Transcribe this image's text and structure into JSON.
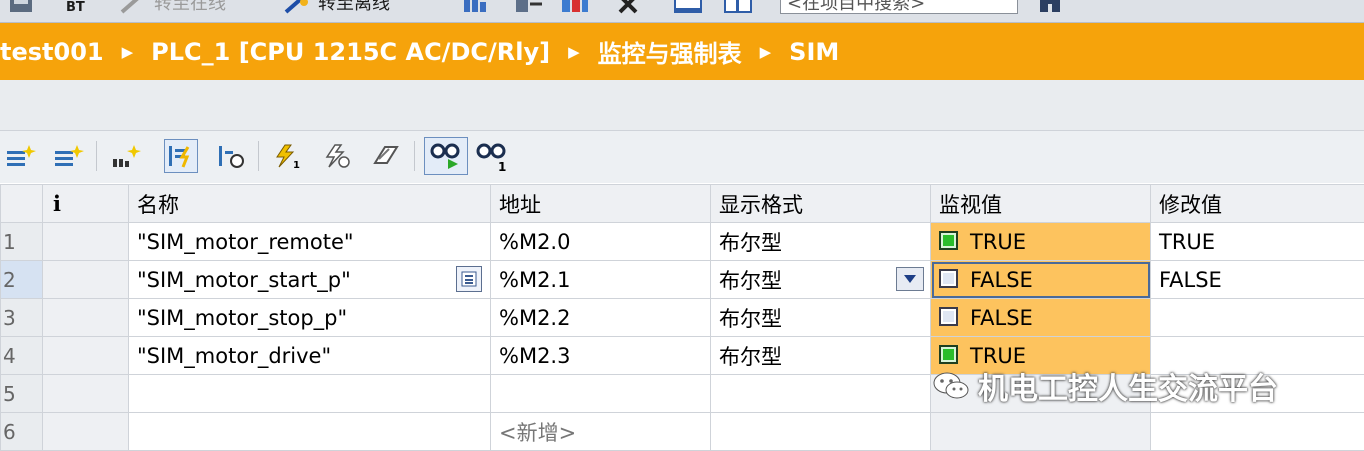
{
  "topbar": {
    "go_online": "转至在线",
    "go_offline": "转至离线",
    "search_placeholder": "<在项目中搜索>",
    "items": [
      "BT"
    ]
  },
  "breadcrumb": [
    "test001",
    "PLC_1 [CPU 1215C AC/DC/Rly]",
    "监控与强制表",
    "SIM"
  ],
  "columns": [
    "i",
    "名称",
    "地址",
    "显示格式",
    "监视值",
    "修改值"
  ],
  "rows": [
    {
      "num": "1",
      "name": "\"SIM_motor_remote\"",
      "address": "%M2.0",
      "format": "布尔型",
      "monitor": "TRUE",
      "monitor_state": "on",
      "modify": "TRUE"
    },
    {
      "num": "2",
      "name": "\"SIM_motor_start_p\"",
      "address": "%M2.1",
      "format": "布尔型",
      "monitor": "FALSE",
      "monitor_state": "off",
      "modify": "FALSE"
    },
    {
      "num": "3",
      "name": "\"SIM_motor_stop_p\"",
      "address": "%M2.2",
      "format": "布尔型",
      "monitor": "FALSE",
      "monitor_state": "off",
      "modify": ""
    },
    {
      "num": "4",
      "name": "\"SIM_motor_drive\"",
      "address": "%M2.3",
      "format": "布尔型",
      "monitor": "TRUE",
      "monitor_state": "on",
      "modify": ""
    },
    {
      "num": "5",
      "name": "",
      "address": "",
      "format": "",
      "monitor": "",
      "monitor_state": "",
      "modify": ""
    },
    {
      "num": "6",
      "name": "",
      "address": "<新增>",
      "format": "",
      "monitor": "",
      "monitor_state": "",
      "modify": ""
    }
  ],
  "watermark": "机电工控人生交流平台",
  "colors": {
    "header_orange": "#f6a30b",
    "monitor_cell": "#fdc35e",
    "true_green": "#2bbd2b"
  }
}
